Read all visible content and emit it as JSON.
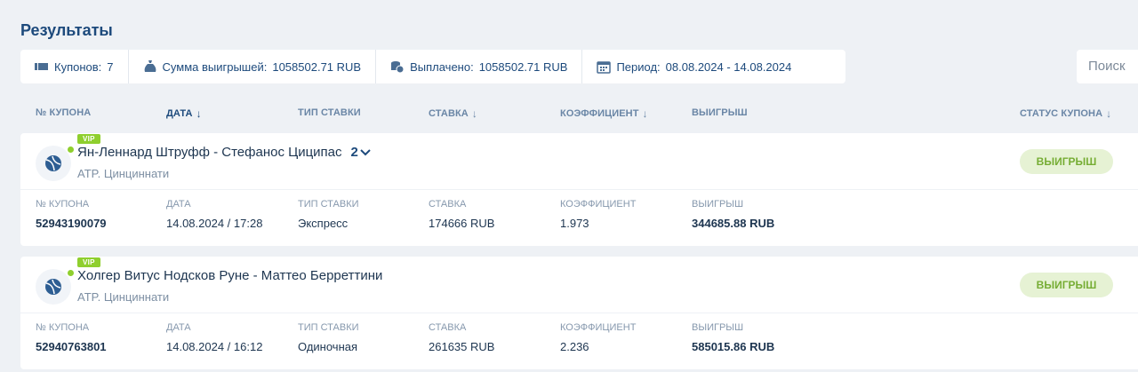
{
  "page": {
    "title": "Результаты"
  },
  "stats": {
    "coupons_label": "Купонов:",
    "coupons_value": "7",
    "winnings_label": "Сумма выигрышей:",
    "winnings_value": "1058502.71 RUB",
    "paid_label": "Выплачено:",
    "paid_value": "1058502.71 RUB",
    "period_label": "Период:",
    "period_value": "08.08.2024 - 14.08.2024"
  },
  "search": {
    "placeholder": "Поиск"
  },
  "columns": {
    "coupon_no": "№ КУПОНА",
    "date": "ДАТА",
    "bet_type": "ТИП СТАВКИ",
    "stake": "СТАВКА",
    "coefficient": "КОЭФФИЦИЕНТ",
    "win": "ВЫИГРЫШ",
    "status": "СТАТУС КУПОНА"
  },
  "coupons": [
    {
      "badge": "VIP",
      "event": "Ян-Леннард Штруфф - Стефанос Циципас",
      "event_count": "2",
      "tournament": "ATP. Цинциннати",
      "status": "ВЫИГРЫШ",
      "coupon_no_label": "№ КУПОНА",
      "coupon_no": "52943190079",
      "date_label": "ДАТА",
      "date": "14.08.2024 / 17:28",
      "bet_type_label": "ТИП СТАВКИ",
      "bet_type": "Экспресс",
      "stake_label": "СТАВКА",
      "stake": "174666 RUB",
      "coefficient_label": "КОЭФФИЦИЕНТ",
      "coefficient": "1.973",
      "win_label": "ВЫИГРЫШ",
      "win": "344685.88 RUB"
    },
    {
      "badge": "VIP",
      "event": "Холгер Витус Нодсков Руне - Маттео Берреттини",
      "event_count": "",
      "tournament": "ATP. Цинциннати",
      "status": "ВЫИГРЫШ",
      "coupon_no_label": "№ КУПОНА",
      "coupon_no": "52940763801",
      "date_label": "ДАТА",
      "date": "14.08.2024 / 16:12",
      "bet_type_label": "ТИП СТАВКИ",
      "bet_type": "Одиночная",
      "stake_label": "СТАВКА",
      "stake": "261635 RUB",
      "coefficient_label": "КОЭФФИЦИЕНТ",
      "coefficient": "2.236",
      "win_label": "ВЫИГРЫШ",
      "win": "585015.86 RUB"
    }
  ],
  "colors": {
    "accent": "#1d4a7c",
    "win_badge_bg": "#e6f2d4",
    "win_badge_text": "#76ad34",
    "vip": "#8fcf2e"
  }
}
